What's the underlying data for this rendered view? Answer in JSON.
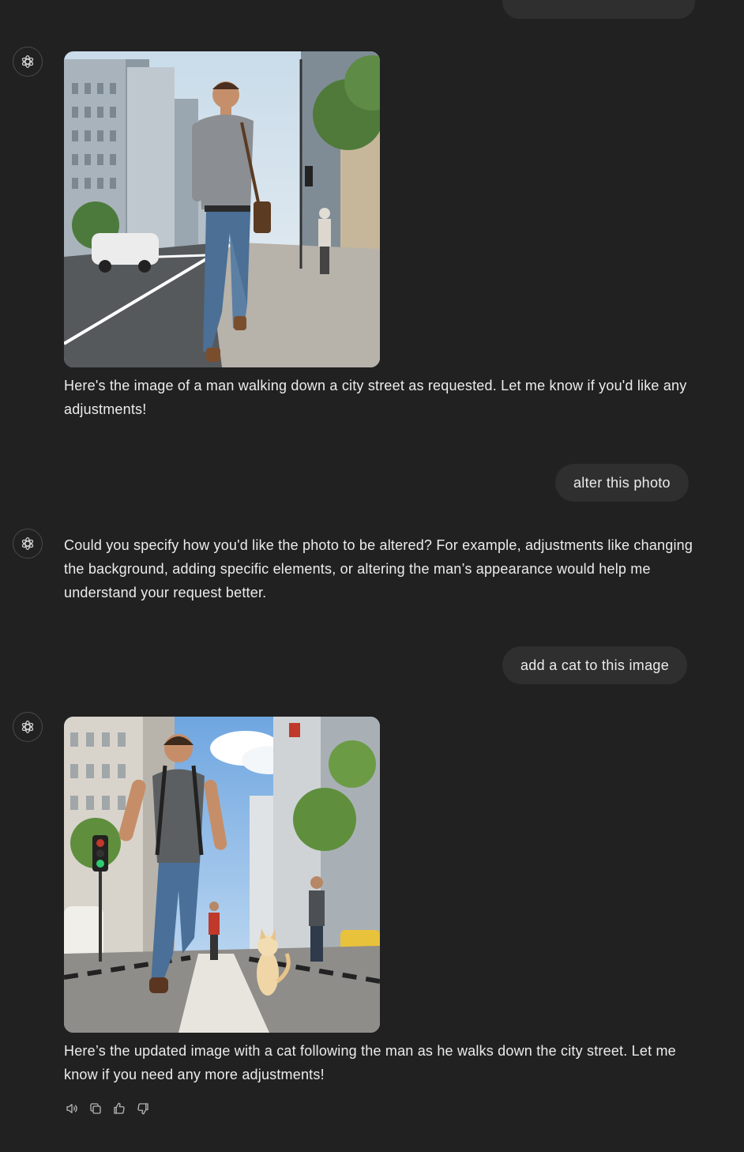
{
  "messages": [
    {
      "role": "assistant",
      "image": {
        "subject": "man walking down a city street"
      },
      "text": "Here's the image of a man walking down a city street as requested. Let me know if you'd like any adjustments!"
    },
    {
      "role": "user",
      "text": "alter this photo"
    },
    {
      "role": "assistant",
      "text": "Could you specify how you'd like the photo to be altered? For example, adjustments like changing the background, adding specific elements, or altering the man’s appearance would help me understand your request better."
    },
    {
      "role": "user",
      "text": "add a cat to this image"
    },
    {
      "role": "assistant",
      "image": {
        "subject": "man walking down a city street with a cat following"
      },
      "text": "Here’s the updated image with a cat following the man as he walks down the city street. Let me know if you need any more adjustments!"
    }
  ],
  "actions": {
    "icons": [
      "speaker-icon",
      "copy-icon",
      "thumbs-up-icon",
      "thumbs-down-icon"
    ]
  },
  "colors": {
    "background": "#212121",
    "bubble": "#2f2f2f",
    "text": "#ececec",
    "icon": "#b4b4b4"
  }
}
